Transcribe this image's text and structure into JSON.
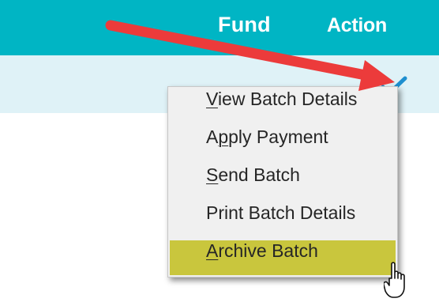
{
  "table": {
    "columns": [
      "Fund",
      "Action"
    ]
  },
  "menu": {
    "items": [
      {
        "pre": "",
        "mn": "V",
        "post": "iew Batch Details"
      },
      {
        "pre": "A",
        "mn": "p",
        "post": "ply Payment"
      },
      {
        "pre": "",
        "mn": "S",
        "post": "end Batch"
      },
      {
        "pre": "Print Batch Details",
        "mn": "",
        "post": ""
      },
      {
        "pre": "",
        "mn": "A",
        "post": "rchive Batch"
      }
    ],
    "highlighted_index": 4
  },
  "colors": {
    "header": "#00b5c4",
    "row": "#dff2f7",
    "highlight": "#c9c63d",
    "arrow": "#ec3b3b"
  },
  "icons": [
    "checkmark-icon",
    "hand-pointer-icon",
    "annotation-arrow"
  ]
}
